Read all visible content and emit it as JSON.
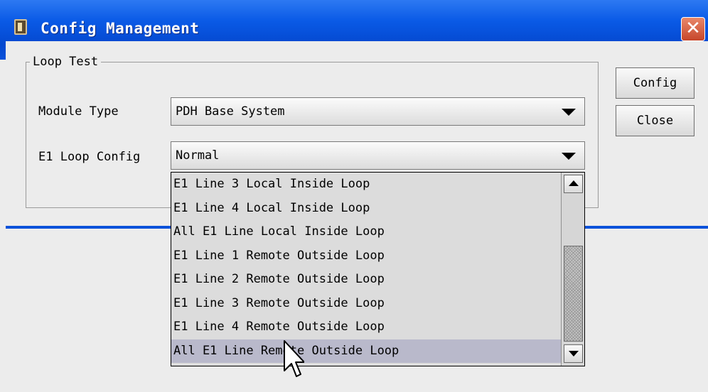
{
  "window": {
    "title": "Config Management",
    "close_glyph": "✕"
  },
  "group": {
    "title": "Loop Test"
  },
  "module_type": {
    "label": "Module Type",
    "value": "PDH Base System"
  },
  "e1_loop": {
    "label": "E1 Loop Config",
    "value": "Normal"
  },
  "buttons": {
    "config": "Config",
    "close": "Close"
  },
  "dropdown": {
    "items": [
      "E1 Line 3 Local Inside Loop",
      "E1 Line 4 Local Inside Loop",
      "All E1 Line Local Inside Loop",
      "E1 Line 1 Remote Outside Loop",
      "E1 Line 2 Remote Outside Loop",
      "E1 Line 3 Remote Outside Loop",
      "E1 Line 4 Remote Outside Loop",
      "All E1 Line Remote Outside Loop"
    ],
    "selected_index": 7
  },
  "colors": {
    "titlebar": "#0a52da",
    "selection": "#b9b9cb",
    "close": "#c6462a"
  }
}
